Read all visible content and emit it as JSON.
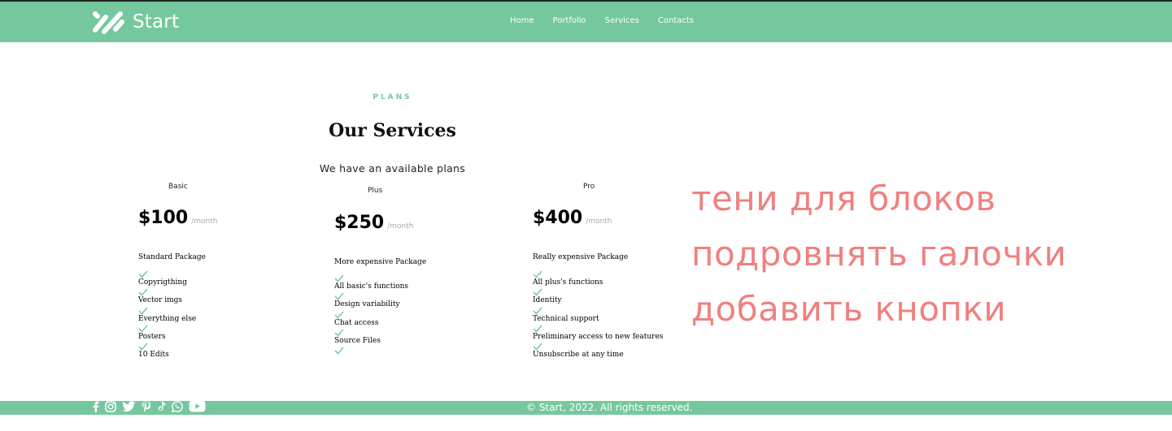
{
  "header": {
    "brand": "Start",
    "nav": [
      "Home",
      "Portfolio",
      "Services",
      "Contacts"
    ]
  },
  "section": {
    "eyebrow": "PLANS",
    "title": "Our Services",
    "subtitle": "We have an available plans"
  },
  "plans": [
    {
      "name": "Basic",
      "price": "$100",
      "period": "/month",
      "package": "Standard Package",
      "features": [
        "Copyrigthing",
        "Vector imgs",
        "Everything else",
        "Posters",
        "10 Edits"
      ]
    },
    {
      "name": "Plus",
      "price": "$250",
      "period": "/month",
      "package": "More expensive Package",
      "features": [
        "All basic's functions",
        "Design variability",
        "Chat access",
        "Source Files",
        ""
      ]
    },
    {
      "name": "Pro",
      "price": "$400",
      "period": "/month",
      "package": "Really expensive Package",
      "features": [
        "All plus's functions",
        "Identity",
        "Technical support",
        "Preliminary access to new features",
        "Unsubscribe at any time"
      ]
    }
  ],
  "notes": [
    "тени для блоков",
    "подровнять галочки",
    "добавить кнопки"
  ],
  "footer": {
    "copyright": "© Start, 2022. All rights reserved.",
    "socials": [
      "facebook-icon",
      "instagram-icon",
      "twitter-icon",
      "pinterest-icon",
      "tiktok-icon",
      "whatsapp-icon",
      "youtube-icon"
    ]
  },
  "colors": {
    "accent": "#75c89e",
    "note": "#f08080",
    "muted": "#aaaaaa"
  }
}
